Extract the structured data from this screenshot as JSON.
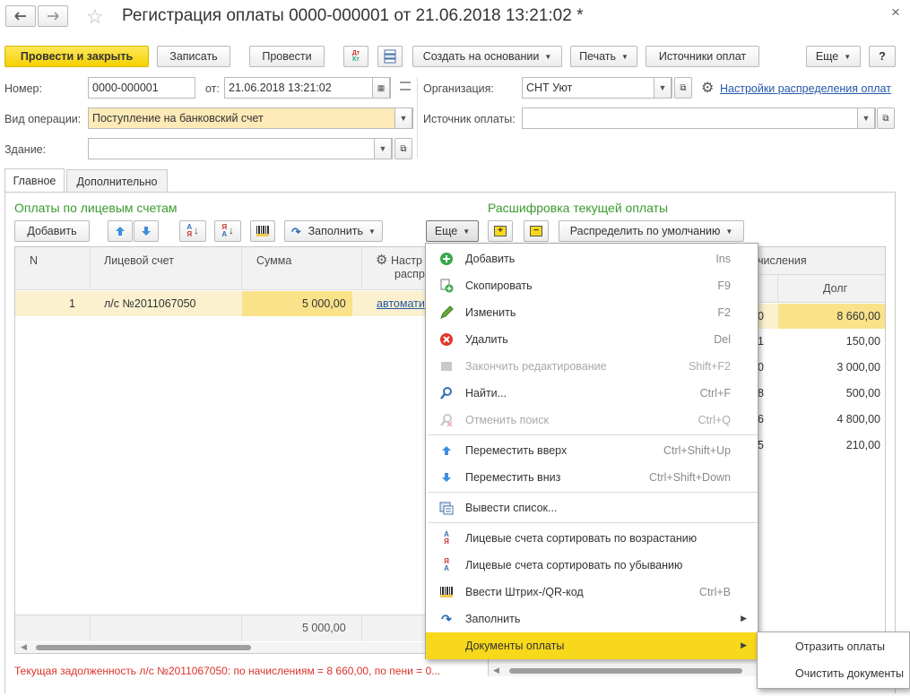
{
  "window": {
    "title": "Регистрация оплаты 0000-000001 от 21.06.2018 13:21:02 *",
    "close": "×"
  },
  "toolbar": {
    "post_close": "Провести и закрыть",
    "save": "Записать",
    "post": "Провести",
    "dtkt": "Дт Кт",
    "create_based": "Создать на основании",
    "print": "Печать",
    "sources": "Источники оплат",
    "more": "Еще",
    "help": "?"
  },
  "header": {
    "number_label": "Номер:",
    "number_value": "0000-000001",
    "from_label": "от:",
    "date_value": "21.06.2018 13:21:02",
    "org_label": "Организация:",
    "org_value": "СНТ Уют",
    "settings_link": "Настройки распределения оплат",
    "op_label": "Вид операции:",
    "op_value": "Поступление на банковский счет",
    "source_label": "Источник оплаты:",
    "source_value": "",
    "building_label": "Здание:",
    "building_value": ""
  },
  "tabs": [
    "Главное",
    "Дополнительно"
  ],
  "left_section": {
    "title": "Оплаты по лицевым счетам",
    "add": "Добавить",
    "fill": "Заполнить",
    "more": "Еще",
    "columns": [
      "N",
      "Лицевой счет",
      "Сумма",
      "Настр",
      "распр"
    ],
    "rows": [
      {
        "n": "1",
        "account": "л/с №2011067050",
        "sum": "5 000,00",
        "setting": "автомати"
      }
    ],
    "total": "5 000,00"
  },
  "right_section": {
    "title": "Расшифровка текущей оплаты",
    "distribute": "Распределить по умолчанию",
    "col_group": "числения",
    "col_debt": "Долг",
    "partial": [
      "0",
      "1",
      "0",
      "8",
      "6",
      "5"
    ],
    "debts": [
      "8 660,00",
      "150,00",
      "3 000,00",
      "500,00",
      "4 800,00",
      "210,00"
    ]
  },
  "status_text": "Текущая задолженность л/с №2011067050: по начислениям = 8 660,00, по пени = 0...",
  "context_menu": {
    "items": [
      {
        "label": "Добавить",
        "key": "Ins",
        "icon": "add-icon"
      },
      {
        "label": "Скопировать",
        "key": "F9",
        "icon": "copy-icon"
      },
      {
        "label": "Изменить",
        "key": "F2",
        "icon": "edit-icon"
      },
      {
        "label": "Удалить",
        "key": "Del",
        "icon": "delete-icon"
      },
      {
        "label": "Закончить редактирование",
        "key": "Shift+F2",
        "icon": "finish-edit-icon"
      },
      {
        "label": "Найти...",
        "key": "Ctrl+F",
        "icon": "find-icon"
      },
      {
        "label": "Отменить поиск",
        "key": "Ctrl+Q",
        "icon": "cancel-search-icon"
      },
      {
        "label": "Переместить вверх",
        "key": "Ctrl+Shift+Up",
        "icon": "arrow-up-icon"
      },
      {
        "label": "Переместить вниз",
        "key": "Ctrl+Shift+Down",
        "icon": "arrow-down-icon"
      },
      {
        "label": "Вывести список...",
        "key": "",
        "icon": "list-output-icon"
      },
      {
        "label": "Лицевые счета сортировать по возрастанию",
        "key": "",
        "icon": "sort-asc-icon"
      },
      {
        "label": "Лицевые счета сортировать по убыванию",
        "key": "",
        "icon": "sort-desc-icon"
      },
      {
        "label": "Ввести Штрих-/QR-код",
        "key": "Ctrl+B",
        "icon": "barcode-icon"
      },
      {
        "label": "Заполнить",
        "key": "",
        "icon": "fill-icon"
      },
      {
        "label": "Документы оплаты",
        "key": "",
        "icon": ""
      }
    ]
  },
  "submenu": {
    "items": [
      "Отразить оплаты",
      "Очистить документы"
    ]
  }
}
